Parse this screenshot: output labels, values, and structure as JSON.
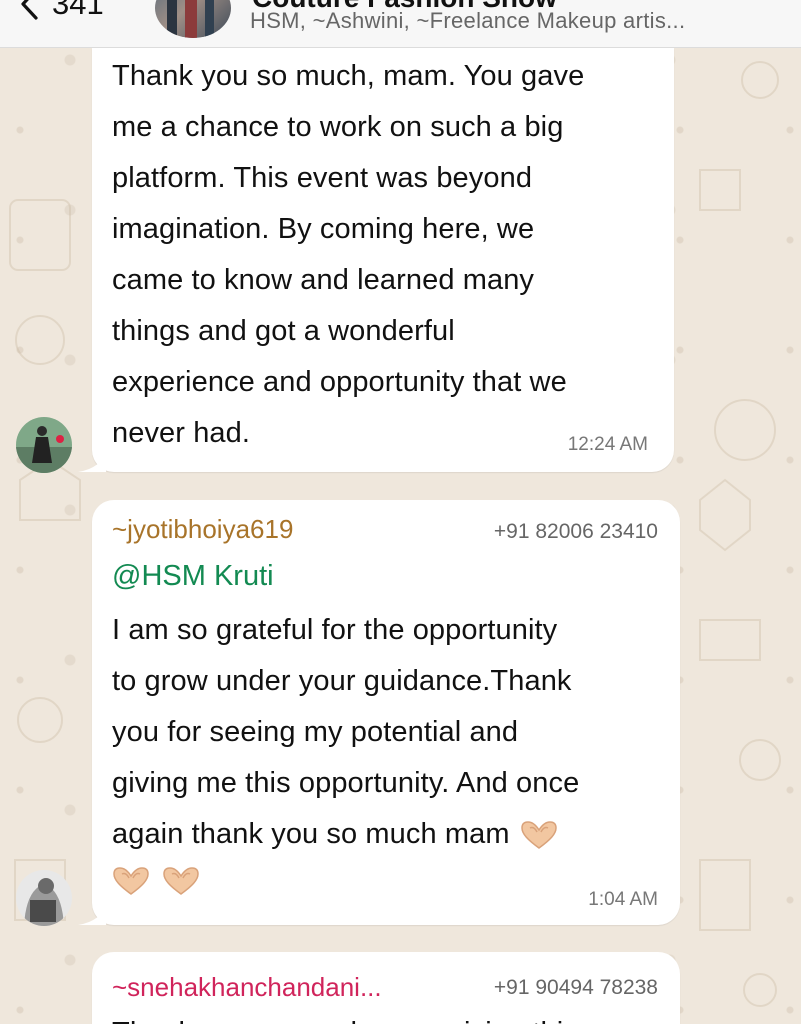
{
  "header": {
    "unread_count": "341",
    "group_title": "Couture Fashion Show",
    "members": "HSM, ~Ashwini, ~Freelance Makeup artis..."
  },
  "messages": [
    {
      "text": "Thank you so much, mam. You gave\nme a chance to work on such a big\nplatform. This event was beyond\nimagination. By coming here, we\ncame to know and learned many\nthings and got a wonderful\nexperience and opportunity that we\nnever had.",
      "time": "12:24 AM"
    },
    {
      "sender": "~jyotibhoiya619",
      "phone": "+91 82006 23410",
      "mention": "@HSM Kruti",
      "text": " I am so grateful for the opportunity\nto grow under your guidance.Thank\nyou for seeing my potential and\ngiving me this opportunity. And once\nagain thank you so much mam",
      "time": "1:04 AM"
    },
    {
      "sender": "~snehakhanchandani...",
      "phone": "+91 90494 78238",
      "text": "Thank you so much mam giving this"
    }
  ],
  "colors": {
    "wallpaper": "#efe7dc",
    "bubble": "#ffffff",
    "sender_jyoti": "#a8742a",
    "sender_sneha": "#d0245b",
    "mention": "#138a52"
  },
  "icons": [
    "chevron-left-icon",
    "heart-hands-emoji"
  ]
}
